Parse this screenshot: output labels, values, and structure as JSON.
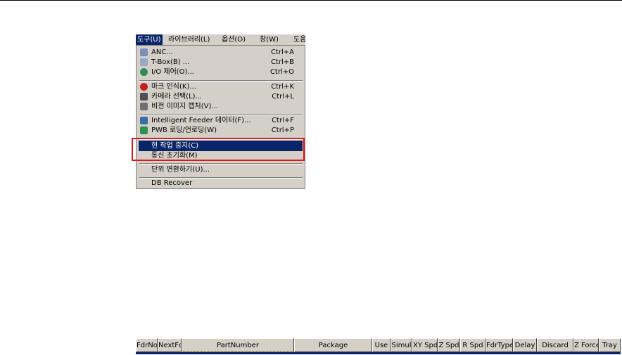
{
  "menubar": {
    "items": [
      "도구(U)",
      "라이브러리(L)",
      "옵션(O)",
      "창(W)",
      "도움"
    ]
  },
  "menu": {
    "items": [
      {
        "label": "ANC...",
        "shortcut": "Ctrl+A",
        "icon": "anc-icon"
      },
      {
        "label": "T-Box(B) ...",
        "shortcut": "Ctrl+B",
        "icon": "tbox-icon"
      },
      {
        "label": "I/O 제어(O)...",
        "shortcut": "Ctrl+O",
        "icon": "io-icon"
      },
      {
        "label": "마크 인식(K)...",
        "shortcut": "Ctrl+K",
        "icon": "mark-recognition-icon"
      },
      {
        "label": "카메라 선택(L)...",
        "shortcut": "Ctrl+L",
        "icon": "camera-icon"
      },
      {
        "label": "비전 이미지 캡처(V)...",
        "shortcut": "",
        "icon": "vision-image-icon"
      },
      {
        "label": "Intelligent Feeder 데이터(F)...",
        "shortcut": "Ctrl+F",
        "icon": "feeder-icon"
      },
      {
        "label": "PWB 로딩/언로딩(W)",
        "shortcut": "Ctrl+P",
        "icon": "pwb-icon"
      },
      {
        "label": "현 작업 중지(C)",
        "shortcut": ""
      },
      {
        "label": "통신 초기화(M)",
        "shortcut": ""
      },
      {
        "label": "단위 변환하기(U)...",
        "shortcut": ""
      },
      {
        "label": "DB Recover",
        "shortcut": ""
      }
    ]
  },
  "table": {
    "columns": [
      "FdrNo",
      "NextFdr",
      "PartNumber",
      "Package",
      "Use",
      "Simul",
      "XY Spd",
      "Z Spd",
      "R Spd",
      "FdrType",
      "Delay",
      "Discard",
      "Z Force",
      "Tray"
    ]
  },
  "colors": {
    "menu_bg": "#d4d0c8",
    "selection": "#0a246a",
    "highlight_border": "#e01818"
  }
}
